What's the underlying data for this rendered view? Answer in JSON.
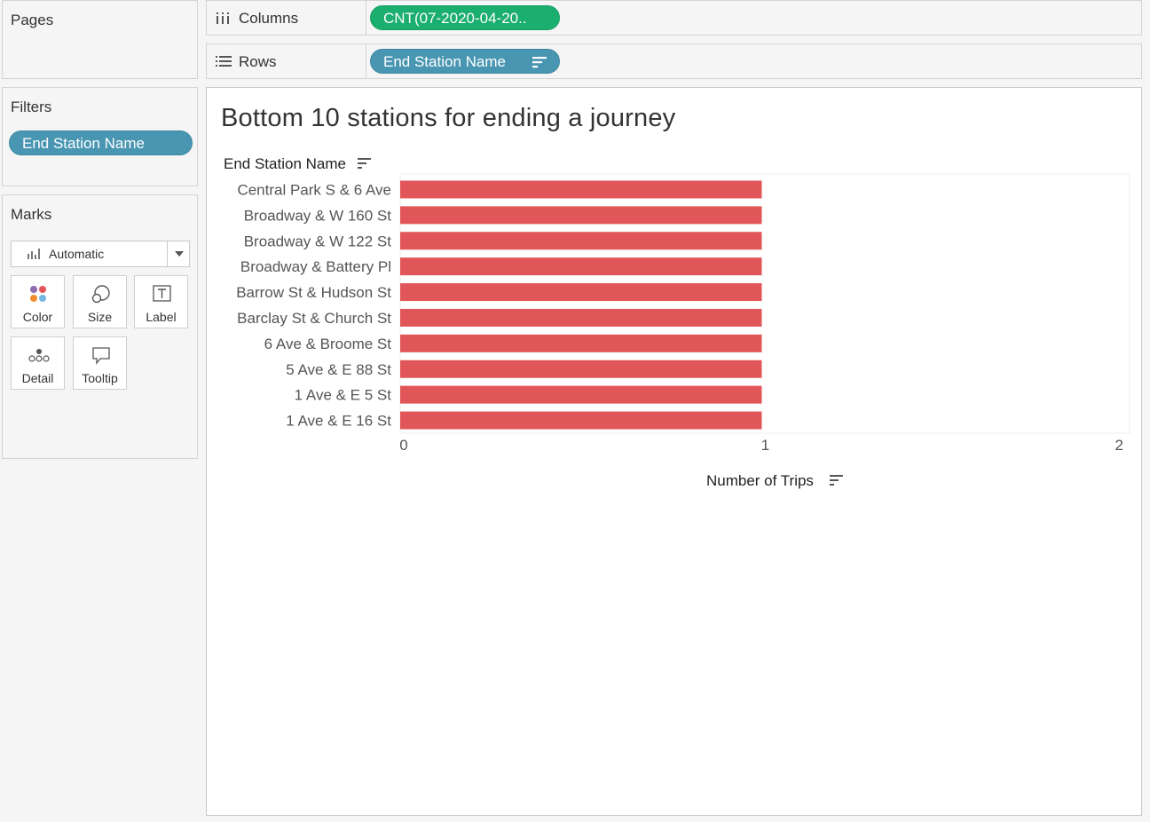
{
  "cards": {
    "pages": {
      "title": "Pages"
    },
    "filters": {
      "title": "Filters",
      "pills": [
        "End Station Name"
      ]
    },
    "marks": {
      "title": "Marks",
      "mark_type": "Automatic",
      "buttons": {
        "color": "Color",
        "size": "Size",
        "label": "Label",
        "detail": "Detail",
        "tooltip": "Tooltip"
      }
    }
  },
  "shelves": {
    "columns": {
      "label": "Columns",
      "pill": "CNT(07-2020-04-20..",
      "pill_color": "#1aae6f"
    },
    "rows": {
      "label": "Rows",
      "pill": "End Station Name",
      "pill_color": "#4996b2"
    }
  },
  "view": {
    "row_header": "End Station Name",
    "x_axis_title": "Number of Trips"
  },
  "chart_data": {
    "type": "bar",
    "orientation": "horizontal",
    "title": "Bottom 10 stations for ending a journey",
    "ylabel": "End Station Name",
    "xlabel": "Number of Trips",
    "categories": [
      "Central Park S & 6 Ave",
      "Broadway & W 160 St",
      "Broadway & W 122 St",
      "Broadway & Battery Pl",
      "Barrow St & Hudson St",
      "Barclay St & Church St",
      "6 Ave & Broome St",
      "5 Ave & E 88 St",
      "1 Ave & E 5 St",
      "1 Ave & E 16 St"
    ],
    "values": [
      1,
      1,
      1,
      1,
      1,
      1,
      1,
      1,
      1,
      1
    ],
    "xlim": [
      0,
      2
    ],
    "xticks": [
      "0",
      "1",
      "2"
    ],
    "bar_color": "#e15759",
    "grid": false
  }
}
